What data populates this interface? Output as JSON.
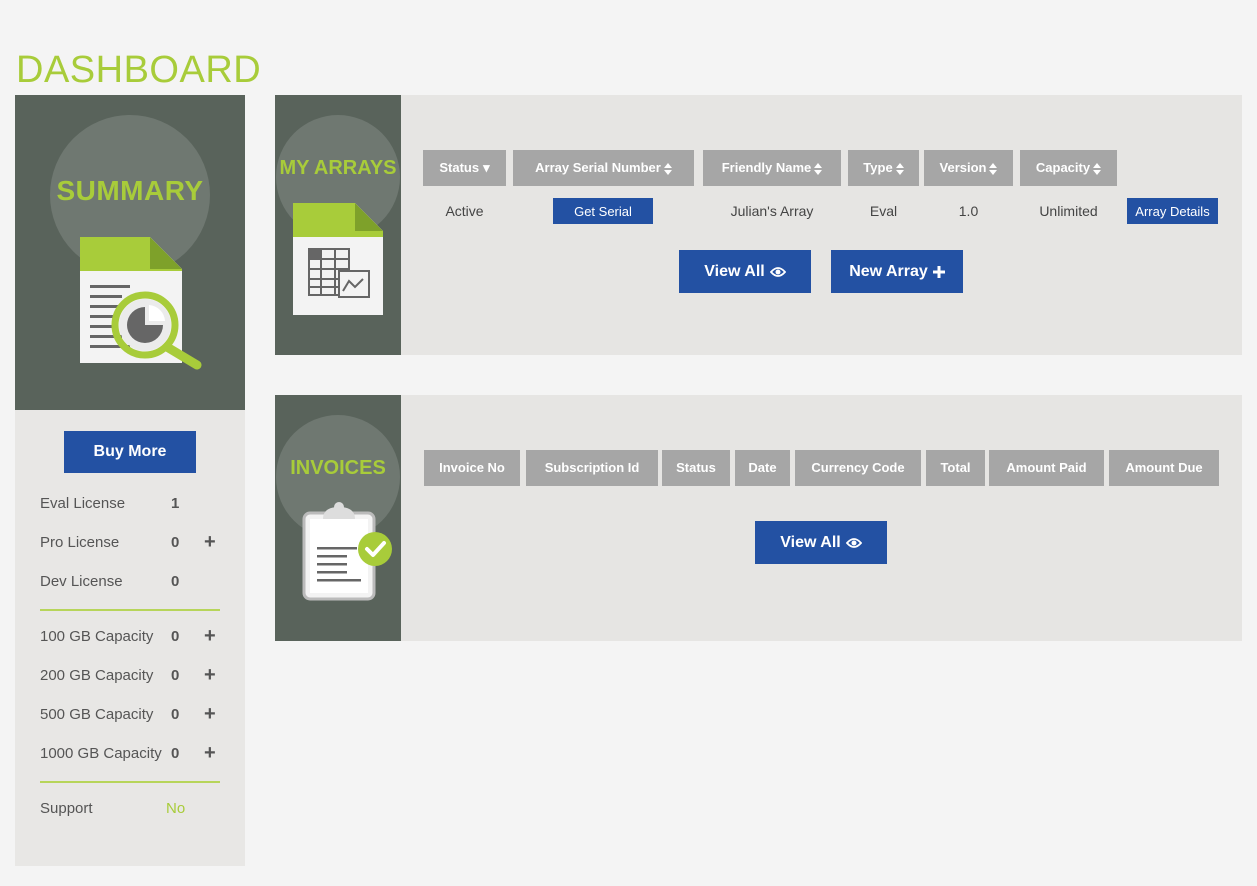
{
  "page": {
    "title": "DASHBOARD"
  },
  "summary": {
    "title": "SUMMARY",
    "buy_more": "Buy More",
    "licenses": [
      {
        "label": "Eval License",
        "count": "1"
      },
      {
        "label": "Pro License",
        "count": "0",
        "plus": "+"
      },
      {
        "label": "Dev License",
        "count": "0"
      }
    ],
    "capacities": [
      {
        "label": "100 GB Capacity",
        "count": "0",
        "plus": "+"
      },
      {
        "label": "200 GB Capacity",
        "count": "0",
        "plus": "+"
      },
      {
        "label": "500 GB Capacity",
        "count": "0",
        "plus": "+"
      },
      {
        "label": "1000 GB Capacity",
        "count": "0",
        "plus": "+"
      }
    ],
    "support": {
      "label": "Support",
      "value": "No"
    }
  },
  "arrays": {
    "title": "MY ARRAYS",
    "headers": [
      "Status",
      "Array Serial Number",
      "Friendly Name",
      "Type",
      "Version",
      "Capacity"
    ],
    "row": {
      "status": "Active",
      "serial_button": "Get Serial",
      "friendly_name": "Julian's Array",
      "type": "Eval",
      "version": "1.0",
      "capacity": "Unlimited",
      "details_button": "Array Details"
    },
    "view_all": "View All",
    "new_array": "New Array"
  },
  "invoices": {
    "title": "INVOICES",
    "headers": [
      "Invoice No",
      "Subscription Id",
      "Status",
      "Date",
      "Currency Code",
      "Total",
      "Amount Paid",
      "Amount Due"
    ],
    "view_all": "View All"
  },
  "colors": {
    "accent_green": "#a8cc3a",
    "primary_blue": "#2351a3",
    "panel_dark": "#59635b",
    "header_gray": "#a6a6a6"
  }
}
